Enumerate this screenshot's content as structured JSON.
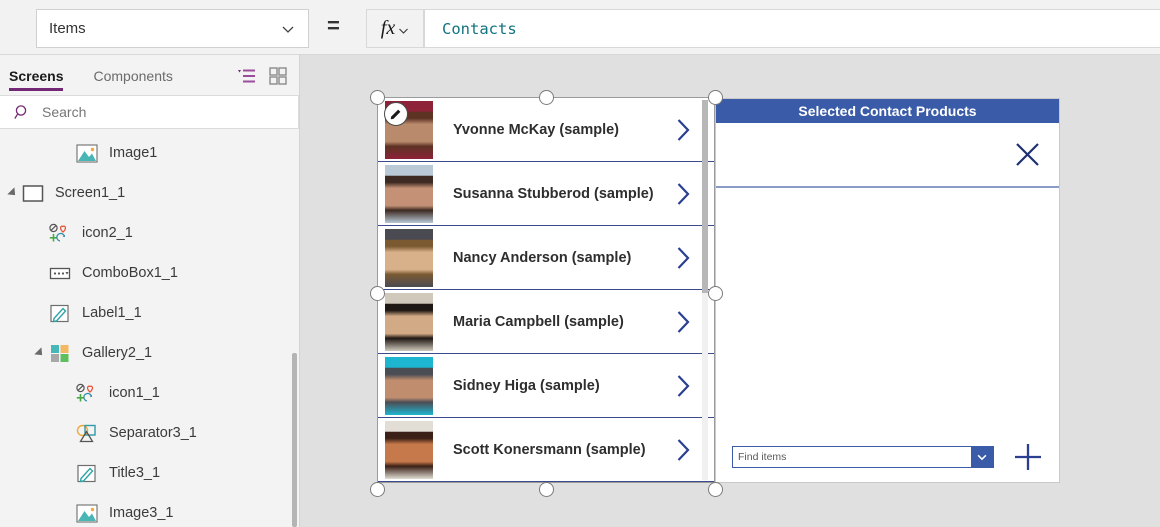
{
  "formula_bar": {
    "property_selected": "Items",
    "equals": "=",
    "fx_label": "fx",
    "formula_value": "Contacts"
  },
  "sidebar": {
    "tabs": [
      {
        "label": "Screens",
        "active": true
      },
      {
        "label": "Components",
        "active": false
      }
    ],
    "view_icons": [
      {
        "name": "tree-view-icon"
      },
      {
        "name": "grid-view-icon"
      }
    ],
    "search": {
      "placeholder": "Search"
    },
    "tree": [
      {
        "label": "Image1",
        "icon": "image-icon",
        "depth": 2,
        "expandable": false
      },
      {
        "label": "Screen1_1",
        "icon": "screen-icon",
        "depth": 0,
        "expandable": true
      },
      {
        "label": "icon2_1",
        "icon": "icons-icon",
        "depth": 1,
        "expandable": false
      },
      {
        "label": "ComboBox1_1",
        "icon": "combobox-icon",
        "depth": 1,
        "expandable": false
      },
      {
        "label": "Label1_1",
        "icon": "label-icon",
        "depth": 1,
        "expandable": false
      },
      {
        "label": "Gallery2_1",
        "icon": "gallery-icon",
        "depth": 1,
        "expandable": true
      },
      {
        "label": "icon1_1",
        "icon": "icons-icon",
        "depth": 2,
        "expandable": false
      },
      {
        "label": "Separator3_1",
        "icon": "shapes-icon",
        "depth": 2,
        "expandable": false
      },
      {
        "label": "Title3_1",
        "icon": "label-icon",
        "depth": 2,
        "expandable": false
      },
      {
        "label": "Image3_1",
        "icon": "image-icon",
        "depth": 2,
        "expandable": false
      }
    ]
  },
  "canvas": {
    "gallery": {
      "items": [
        {
          "name": "Yvonne McKay (sample)",
          "photo_colors": [
            "#b98a6b",
            "#5d3324",
            "#8d2238"
          ]
        },
        {
          "name": "Susanna Stubberod (sample)",
          "photo_colors": [
            "#c49176",
            "#3d2a22",
            "#b9c9d6"
          ]
        },
        {
          "name": "Nancy Anderson (sample)",
          "photo_colors": [
            "#d8b08a",
            "#7b5a32",
            "#4a4a52"
          ]
        },
        {
          "name": "Maria Campbell (sample)",
          "photo_colors": [
            "#d3aa86",
            "#1f1713",
            "#cfc8bb"
          ]
        },
        {
          "name": "Sidney Higa (sample)",
          "photo_colors": [
            "#c08d6e",
            "#4b4d55",
            "#1eb5d0"
          ]
        },
        {
          "name": "Scott Konersmann (sample)",
          "photo_colors": [
            "#c6794a",
            "#3a2016",
            "#e2ded5"
          ]
        }
      ],
      "chevron_icon": "chevron-right-icon",
      "edit_badge_icon": "pencil-icon"
    },
    "right_panel": {
      "title": "Selected Contact Products",
      "close_icon": "close-x-icon",
      "combobox": {
        "placeholder": "Find items",
        "chevron_icon": "chevron-down-icon"
      },
      "add_icon": "plus-icon"
    }
  },
  "colors": {
    "accent_purple": "#742774",
    "panel_blue": "#3a5ca8",
    "formula_teal": "#11737f",
    "canvas_gray": "#e0e0e0",
    "separator_navy": "#3a4a8a"
  }
}
